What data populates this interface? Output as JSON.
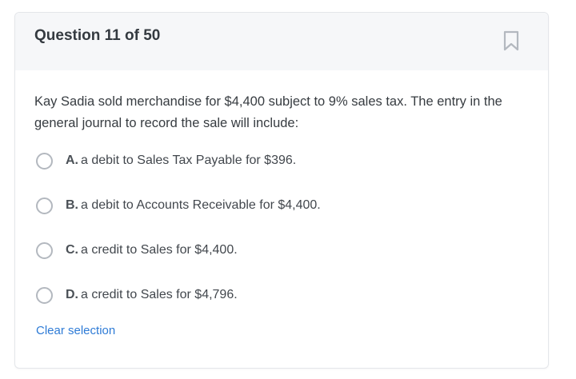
{
  "question": {
    "title": "Question 11 of 50",
    "prompt": "Kay Sadia sold merchandise for $4,400 subject to 9% sales tax. The entry in the general journal to record the sale will include:",
    "bookmark_icon": "bookmark-icon"
  },
  "options": [
    {
      "letter": "A.",
      "text": "a debit to Sales Tax Payable for $396."
    },
    {
      "letter": "B.",
      "text": "a debit to Accounts Receivable for $4,400."
    },
    {
      "letter": "C.",
      "text": "a credit to Sales for $4,400."
    },
    {
      "letter": "D.",
      "text": "a credit to Sales for $4,796."
    }
  ],
  "clear_label": "Clear selection",
  "colors": {
    "header_bg": "#f6f7f9",
    "link": "#2e7bd6",
    "radio_border": "#b3b8bf"
  }
}
